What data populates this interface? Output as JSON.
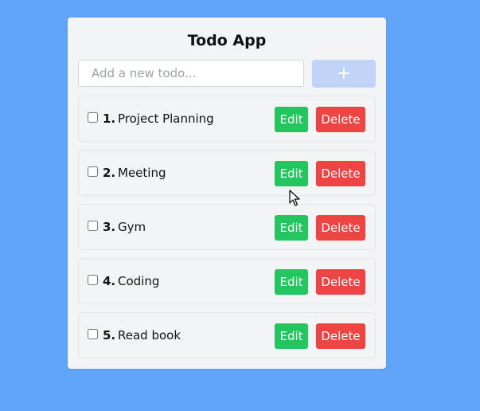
{
  "app": {
    "title": "Todo App"
  },
  "new_todo": {
    "placeholder": "Add a new todo...",
    "value": "",
    "add_label": "+"
  },
  "todos": [
    {
      "number": "1.",
      "text": "Project Planning",
      "done": false,
      "edit_label": "Edit",
      "delete_label": "Delete"
    },
    {
      "number": "2.",
      "text": "Meeting",
      "done": false,
      "edit_label": "Edit",
      "delete_label": "Delete"
    },
    {
      "number": "3.",
      "text": "Gym",
      "done": false,
      "edit_label": "Edit",
      "delete_label": "Delete"
    },
    {
      "number": "4.",
      "text": "Coding",
      "done": false,
      "edit_label": "Edit",
      "delete_label": "Delete"
    },
    {
      "number": "5.",
      "text": "Read book",
      "done": false,
      "edit_label": "Edit",
      "delete_label": "Delete"
    }
  ],
  "colors": {
    "background": "#60a5fa",
    "card": "#f3f4f6",
    "add_button": "#bfd4f6",
    "edit_button": "#22c55e",
    "delete_button": "#ef4444"
  },
  "icons": {
    "cursor": "mouse-pointer-icon"
  }
}
